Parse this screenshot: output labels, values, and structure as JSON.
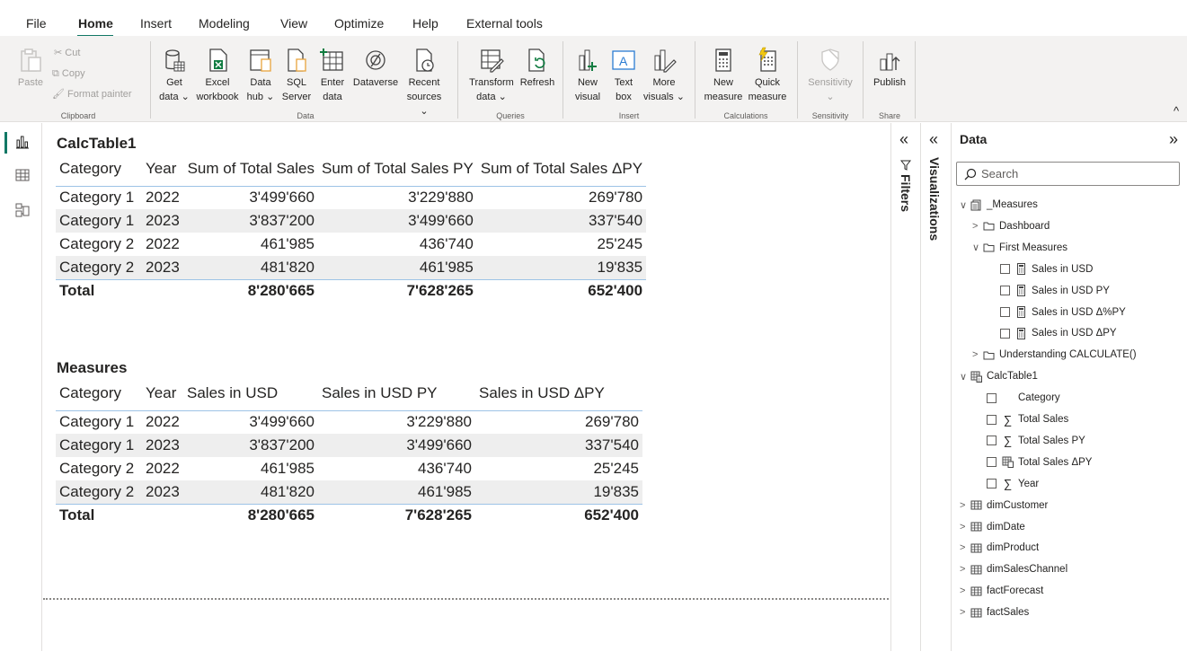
{
  "menu": {
    "items": [
      "File",
      "Home",
      "Insert",
      "Modeling",
      "View",
      "Optimize",
      "Help",
      "External tools"
    ],
    "active": "Home"
  },
  "ribbon": {
    "clipboard": {
      "paste": "Paste",
      "cut": "Cut",
      "copy": "Copy",
      "format_painter": "Format painter",
      "label": "Clipboard"
    },
    "data": {
      "get_data": [
        "Get",
        "data ⌄"
      ],
      "excel": [
        "Excel",
        "workbook"
      ],
      "data_hub": [
        "Data",
        "hub ⌄"
      ],
      "sql": [
        "SQL",
        "Server"
      ],
      "enter_data": [
        "Enter",
        "data"
      ],
      "dataverse": "Dataverse",
      "recent": [
        "Recent",
        "sources ⌄"
      ],
      "label": "Data"
    },
    "queries": {
      "transform": [
        "Transform",
        "data ⌄"
      ],
      "refresh": "Refresh",
      "label": "Queries"
    },
    "insert": {
      "new_visual": [
        "New",
        "visual"
      ],
      "text_box": [
        "Text",
        "box"
      ],
      "more_visuals": [
        "More",
        "visuals ⌄"
      ],
      "label": "Insert"
    },
    "calculations": {
      "new_measure": [
        "New",
        "measure"
      ],
      "quick_measure": [
        "Quick",
        "measure"
      ],
      "label": "Calculations"
    },
    "sensitivity": {
      "button": "Sensitivity",
      "sub": "⌄",
      "label": "Sensitivity"
    },
    "share": {
      "publish": "Publish",
      "label": "Share"
    },
    "collapse": "^"
  },
  "visuals": [
    {
      "title": "CalcTable1",
      "headers": [
        "Category",
        "Year",
        "Sum of Total Sales",
        "Sum of Total Sales PY",
        "Sum of Total Sales ΔPY"
      ],
      "rows": [
        [
          "Category 1",
          "2022",
          "3'499'660",
          "3'229'880",
          "269'780"
        ],
        [
          "Category 1",
          "2023",
          "3'837'200",
          "3'499'660",
          "337'540"
        ],
        [
          "Category 2",
          "2022",
          "461'985",
          "436'740",
          "25'245"
        ],
        [
          "Category 2",
          "2023",
          "481'820",
          "461'985",
          "19'835"
        ]
      ],
      "total": [
        "Total",
        "",
        "8'280'665",
        "7'628'265",
        "652'400"
      ]
    },
    {
      "title": "Measures",
      "headers": [
        "Category",
        "Year",
        "Sales in USD",
        "Sales in USD PY",
        "Sales in USD ΔPY"
      ],
      "rows": [
        [
          "Category 1",
          "2022",
          "3'499'660",
          "3'229'880",
          "269'780"
        ],
        [
          "Category 1",
          "2023",
          "3'837'200",
          "3'499'660",
          "337'540"
        ],
        [
          "Category 2",
          "2022",
          "461'985",
          "436'740",
          "25'245"
        ],
        [
          "Category 2",
          "2023",
          "481'820",
          "461'985",
          "19'835"
        ]
      ],
      "total": [
        "Total",
        "",
        "8'280'665",
        "7'628'265",
        "652'400"
      ]
    }
  ],
  "panes": {
    "filters": "Filters",
    "visualizations": "Visualizations",
    "collapse_glyph": "«",
    "expand_glyph": "»"
  },
  "data_pane": {
    "title": "Data",
    "search_placeholder": "Search",
    "tree": [
      {
        "label": "_Measures",
        "level": 0,
        "chev": "∨",
        "icon": "measure-table",
        "checkbox": false
      },
      {
        "label": "Dashboard",
        "level": 1,
        "chev": ">",
        "icon": "folder",
        "checkbox": false
      },
      {
        "label": "First Measures",
        "level": 1,
        "chev": "∨",
        "icon": "folder",
        "checkbox": false
      },
      {
        "label": "Sales in USD",
        "level": 2,
        "chev": "",
        "icon": "calculator",
        "checkbox": true
      },
      {
        "label": "Sales in USD PY",
        "level": 2,
        "chev": "",
        "icon": "calculator",
        "checkbox": true
      },
      {
        "label": "Sales in USD Δ%PY",
        "level": 2,
        "chev": "",
        "icon": "calculator",
        "checkbox": true
      },
      {
        "label": "Sales in USD ΔPY",
        "level": 2,
        "chev": "",
        "icon": "calculator",
        "checkbox": true
      },
      {
        "label": "Understanding CALCULATE()",
        "level": 1,
        "chev": ">",
        "icon": "folder",
        "checkbox": false
      },
      {
        "label": "CalcTable1",
        "level": 0,
        "chev": "∨",
        "icon": "calc-table",
        "checkbox": false
      },
      {
        "label": "Category",
        "level": 1.5,
        "chev": "",
        "icon": "none",
        "checkbox": true
      },
      {
        "label": "Total Sales",
        "level": 1.5,
        "chev": "",
        "icon": "sigma",
        "checkbox": true
      },
      {
        "label": "Total Sales PY",
        "level": 1.5,
        "chev": "",
        "icon": "sigma",
        "checkbox": true
      },
      {
        "label": "Total Sales ΔPY",
        "level": 1.5,
        "chev": "",
        "icon": "calc-column",
        "checkbox": true
      },
      {
        "label": "Year",
        "level": 1.5,
        "chev": "",
        "icon": "sigma",
        "checkbox": true
      },
      {
        "label": "dimCustomer",
        "level": 0,
        "chev": ">",
        "icon": "table",
        "checkbox": false
      },
      {
        "label": "dimDate",
        "level": 0,
        "chev": ">",
        "icon": "table",
        "checkbox": false
      },
      {
        "label": "dimProduct",
        "level": 0,
        "chev": ">",
        "icon": "table",
        "checkbox": false
      },
      {
        "label": "dimSalesChannel",
        "level": 0,
        "chev": ">",
        "icon": "table",
        "checkbox": false
      },
      {
        "label": "factForecast",
        "level": 0,
        "chev": ">",
        "icon": "table",
        "checkbox": false
      },
      {
        "label": "factSales",
        "level": 0,
        "chev": ">",
        "icon": "table",
        "checkbox": false
      }
    ]
  },
  "colors": {
    "accent": "#117865",
    "table_border": "#9dc3e6",
    "row_alt": "#eeeeee",
    "ribbon_bg": "#f3f2f1"
  }
}
